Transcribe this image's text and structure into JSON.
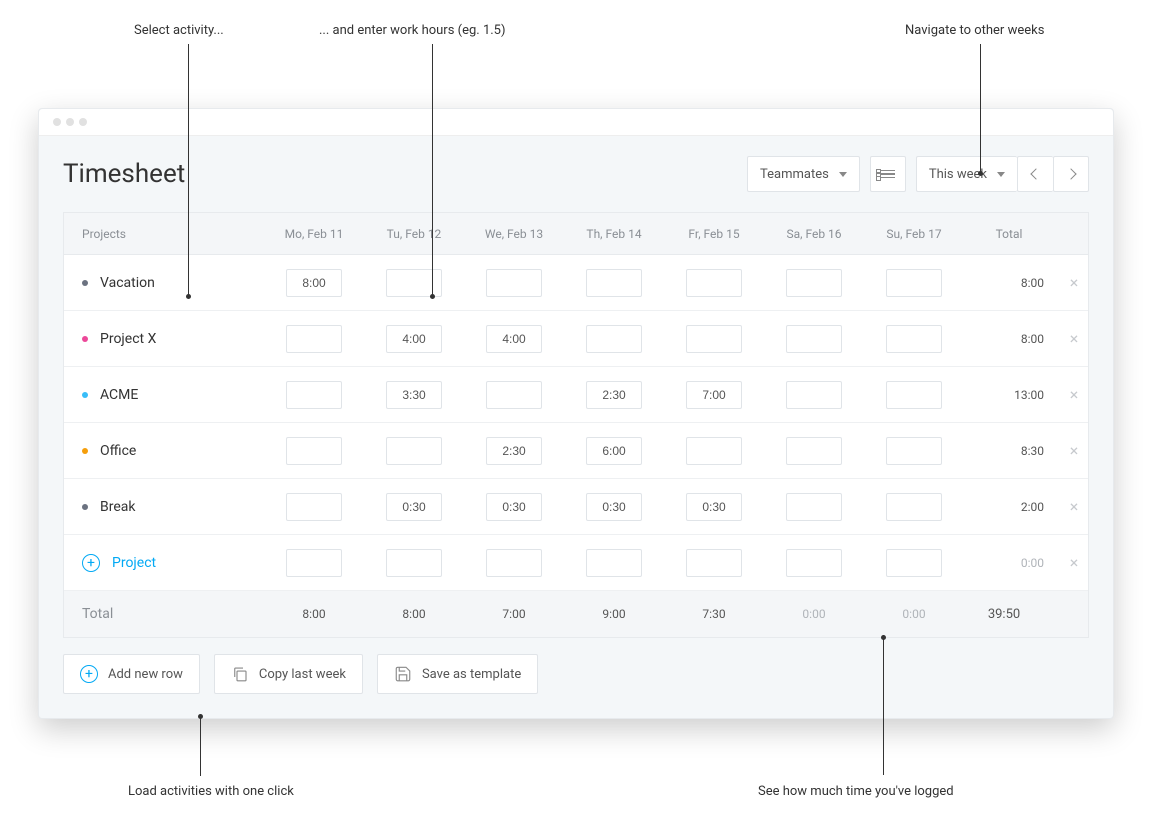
{
  "annotations": {
    "select_activity": "Select activity...",
    "enter_hours": "... and enter work hours (eg. 1.5)",
    "navigate_weeks": "Navigate to other weeks",
    "load_activities": "Load activities with one click",
    "see_logged": "See how much time you've logged"
  },
  "header": {
    "title": "Timesheet",
    "teammates_label": "Teammates",
    "week_label": "This week"
  },
  "table": {
    "projects_header": "Projects",
    "total_header": "Total",
    "total_footer_label": "Total",
    "days": [
      "Mo, Feb 11",
      "Tu, Feb 12",
      "We, Feb 13",
      "Th, Feb 14",
      "Fr, Feb 15",
      "Sa, Feb 16",
      "Su, Feb 17"
    ],
    "rows": [
      {
        "dot": "#6b7280",
        "name": "Vacation",
        "cells": [
          "8:00",
          "",
          "",
          "",
          "",
          "",
          ""
        ],
        "total": "8:00"
      },
      {
        "dot": "#ec4899",
        "name": "Project X",
        "cells": [
          "",
          "4:00",
          "4:00",
          "",
          "",
          "",
          ""
        ],
        "total": "8:00"
      },
      {
        "dot": "#38bdf8",
        "name": "ACME",
        "cells": [
          "",
          "3:30",
          "",
          "2:30",
          "7:00",
          "",
          ""
        ],
        "total": "13:00"
      },
      {
        "dot": "#f59e0b",
        "name": "Office",
        "cells": [
          "",
          "",
          "2:30",
          "6:00",
          "",
          "",
          ""
        ],
        "total": "8:30"
      },
      {
        "dot": "#6b7280",
        "name": "Break",
        "cells": [
          "",
          "0:30",
          "0:30",
          "0:30",
          "0:30",
          "",
          ""
        ],
        "total": "2:00"
      }
    ],
    "new_row": {
      "label": "Project",
      "cells": [
        "",
        "",
        "",
        "",
        "",
        "",
        ""
      ],
      "total": "0:00"
    },
    "day_totals": [
      "8:00",
      "8:00",
      "7:00",
      "9:00",
      "7:30",
      "0:00",
      "0:00"
    ],
    "grand_total": "39:50"
  },
  "actions": {
    "add_row": "Add new row",
    "copy_last": "Copy last week",
    "save_template": "Save as template"
  }
}
